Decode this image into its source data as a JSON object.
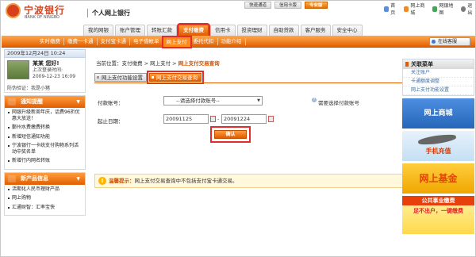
{
  "header": {
    "bank_name": "宁波银行",
    "bank_name_en": "BANK OF NINGBO",
    "system_title": "个人网上银行",
    "top_buttons": [
      "快速通道",
      "信用卡版",
      "专业版"
    ],
    "top_links": [
      "首页",
      "网上商城",
      "网银地图",
      "退出"
    ]
  },
  "main_tabs": [
    "我的网银",
    "账户管理",
    "转账汇款",
    "支付缴费",
    "信用卡",
    "投资理财",
    "自助贷款",
    "客户服务",
    "安全中心"
  ],
  "sub_nav": [
    "实时缴费",
    "缴费一卡通",
    "支付宝卡通",
    "电子借帐单",
    "网上支付",
    "委托代扣",
    "功能介绍"
  ],
  "customer_service": "在线客服",
  "user": {
    "datetime": "2009年12月24日 10:24",
    "name": "某某 您好!",
    "last_login_label": "上次登录时间:",
    "last_login_time": "2009-12-23 16:09",
    "anti_phishing": "防伪验证：我是小猪"
  },
  "notice_panel": {
    "title": "通知提醒",
    "items": [
      "网银升级新周年庆，话费96折优惠大放送！",
      "鄞州水费缴费转换",
      "新增短信通知功能",
      "宁波银行一卡统支付购物系列活动中奖名单",
      "新增行内网名转账"
    ]
  },
  "product_panel": {
    "title": "新产品信息",
    "items": [
      "活期化人民币理财产品",
      "网上购物",
      "汇通财智：汇率宝快"
    ]
  },
  "breadcrumb": {
    "prefix": "当前位置：支付缴费 > 网上支付 > ",
    "current": "网上支付交易查询"
  },
  "content_tabs": [
    "网上支付功能设置",
    "网上支付交易查询"
  ],
  "form": {
    "account_label": "付款账号：",
    "account_select": "--请选择付款账号--",
    "need_account": "需要选择付款账号",
    "date_label": "起止日期：",
    "start_date": "20091125",
    "end_date": "20091224",
    "date_sep": "-",
    "confirm_label": "确认"
  },
  "tip": {
    "label": "温馨提示：",
    "text": "网上支付交易查询中不包括支付宝卡通交易。"
  },
  "right_menu": {
    "title": "关联菜单",
    "items": [
      "关注账户",
      "卡通额度调整",
      "网上支付功能设置"
    ]
  },
  "banners": {
    "shop": "网上商城",
    "phone": "手机充值",
    "fund": "网上基金",
    "public_title": "公共事业缴费",
    "public_sub": "足不出户，一键缴费"
  },
  "colors": {
    "accent": "#e35b00",
    "highlight_box": "#e62b2b",
    "logo": "#d64521"
  }
}
